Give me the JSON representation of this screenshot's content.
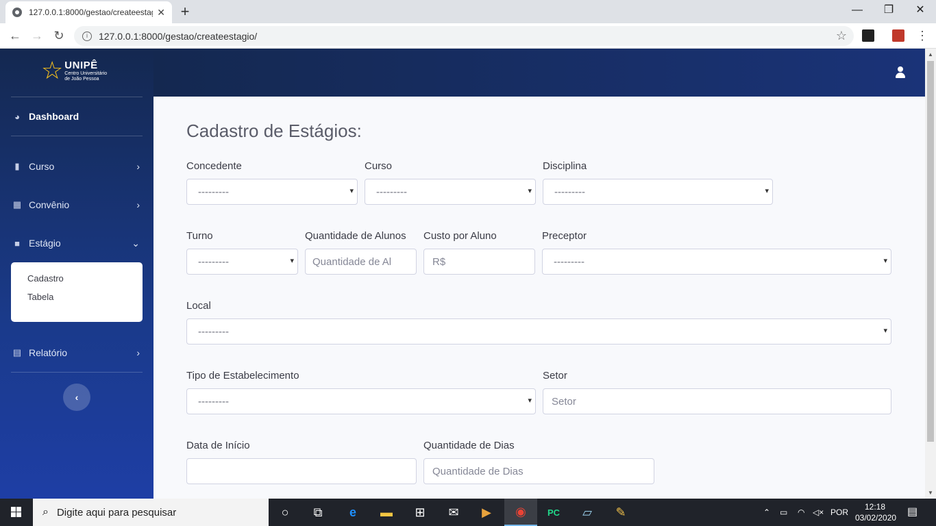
{
  "browser": {
    "tab_title": "127.0.0.1:8000/gestao/createestagio/",
    "tab_close": "✕",
    "new_tab": "+",
    "url": "127.0.0.1:8000/gestao/createestagio/",
    "window_controls": {
      "minimize": "—",
      "maximize": "❐",
      "close": "✕"
    }
  },
  "sidebar": {
    "brand": {
      "name": "UNIPÊ",
      "sub1": "Centro Universitário",
      "sub2": "de João Pessoa"
    },
    "dashboard": "Dashboard",
    "items": [
      {
        "label": "Curso",
        "icon": "bookmark-icon"
      },
      {
        "label": "Convênio",
        "icon": "building-icon"
      },
      {
        "label": "Estágio",
        "icon": "folder-icon"
      },
      {
        "label": "Relatório",
        "icon": "report-icon"
      }
    ],
    "submenu": [
      "Cadastro",
      "Tabela"
    ],
    "toggle": "‹"
  },
  "form": {
    "title": "Cadastro de Estágios:",
    "fields": {
      "concedente": {
        "label": "Concedente",
        "value": "---------"
      },
      "curso": {
        "label": "Curso",
        "value": "---------"
      },
      "disciplina": {
        "label": "Disciplina",
        "value": "---------"
      },
      "turno": {
        "label": "Turno",
        "value": "---------"
      },
      "qtd_alunos": {
        "label": "Quantidade de Alunos",
        "placeholder": "Quantidade de Al"
      },
      "custo": {
        "label": "Custo por Aluno",
        "placeholder": "R$"
      },
      "preceptor": {
        "label": "Preceptor",
        "value": "---------"
      },
      "local": {
        "label": "Local",
        "value": "---------"
      },
      "tipo": {
        "label": "Tipo de Estabelecimento",
        "value": "---------"
      },
      "setor": {
        "label": "Setor",
        "placeholder": "Setor"
      },
      "data_inicio": {
        "label": "Data de Início",
        "value": ""
      },
      "qtd_dias": {
        "label": "Quantidade de Dias",
        "placeholder": "Quantidade de Dias"
      }
    }
  },
  "taskbar": {
    "search_placeholder": "Digite aqui para pesquisar",
    "language": "POR",
    "time": "12:18",
    "date": "03/02/2020"
  }
}
